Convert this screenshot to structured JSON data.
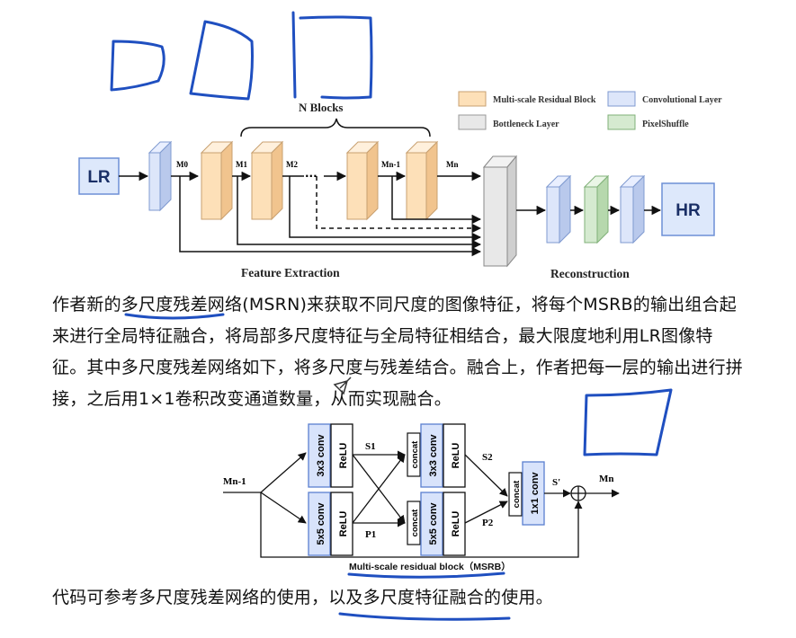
{
  "top_diagram": {
    "legend": {
      "multi_scale": "Multi-scale Residual Block",
      "conv": "Convolutional Layer",
      "bottleneck": "Bottleneck Layer",
      "pixelshuffle": "PixelShuffle",
      "colors": {
        "multi_scale": "#fde0b8",
        "conv": "#dde6fa",
        "bottleneck": "#e8e8e8",
        "pixelshuffle": "#d5ead0"
      }
    },
    "input_label": "LR",
    "output_label": "HR",
    "n_blocks_label": "N Blocks",
    "m_labels": [
      "M0",
      "M1",
      "M2",
      "Mn-1",
      "Mn"
    ],
    "ellipsis": "···",
    "feature_extraction_label": "Feature Extraction",
    "reconstruction_label": "Reconstruction"
  },
  "paragraph1": {
    "lines": [
      "作者新的多尺度残差网络(MSRN)来获取不同尺度的图像特征，将每个MSRB的输出组合起",
      "来进行全局特征融合，将局部多尺度特征与全局特征相结合，最大限度地利用LR图像特",
      "征。其中多尺度残差网络如下，将多尺度与残差结合。融合上，作者把每一层的输出进行拼",
      "接，之后用1×1卷积改变通道数量，从而实现融合。"
    ]
  },
  "msrb_diagram": {
    "input_label": "Mn-1",
    "output_label": "Mn",
    "conv3_label": "3x3 conv",
    "conv5_label": "5x5 conv",
    "relu_label": "ReLU",
    "concat_label": "concat",
    "conv1_label": "1x1 conv",
    "s1": "S1",
    "s2": "S2",
    "p1": "P1",
    "p2": "P2",
    "s_prime": "S'",
    "caption": "Multi-scale residual block（MSRB）",
    "colors": {
      "conv_fill": "#d8e3fb",
      "conv_stroke": "#5b7fd0"
    }
  },
  "paragraph2": {
    "text": "代码可参考多尺度残差网络的使用，以及多尺度特征融合的使用。"
  }
}
